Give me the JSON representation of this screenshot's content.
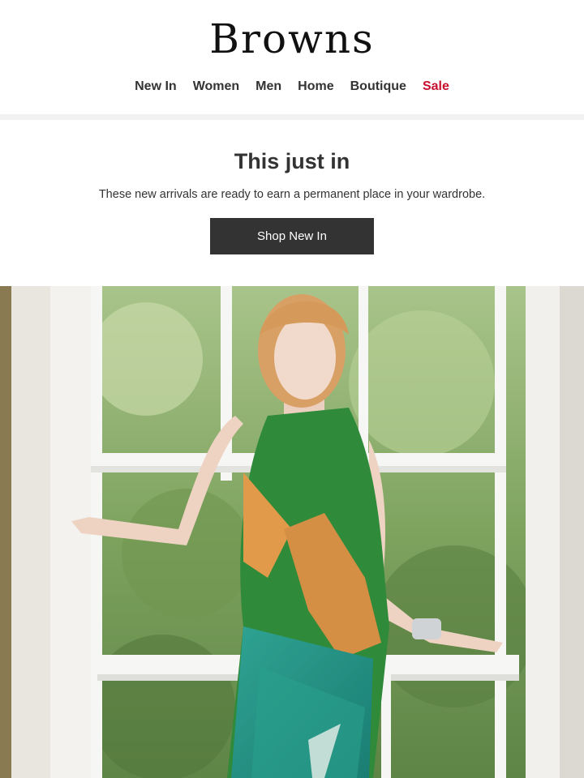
{
  "brand": {
    "logo_text": "Browns"
  },
  "nav": {
    "items": [
      "New In",
      "Women",
      "Men",
      "Home",
      "Boutique"
    ],
    "sale": "Sale",
    "sale_color": "#c8102e"
  },
  "hero": {
    "title": "This just in",
    "subtitle": "These new arrivals are ready to earn a permanent place in your wardrobe.",
    "cta_label": "Shop New In"
  },
  "colors": {
    "button_bg": "#333333",
    "divider": "#f1f1f1"
  }
}
